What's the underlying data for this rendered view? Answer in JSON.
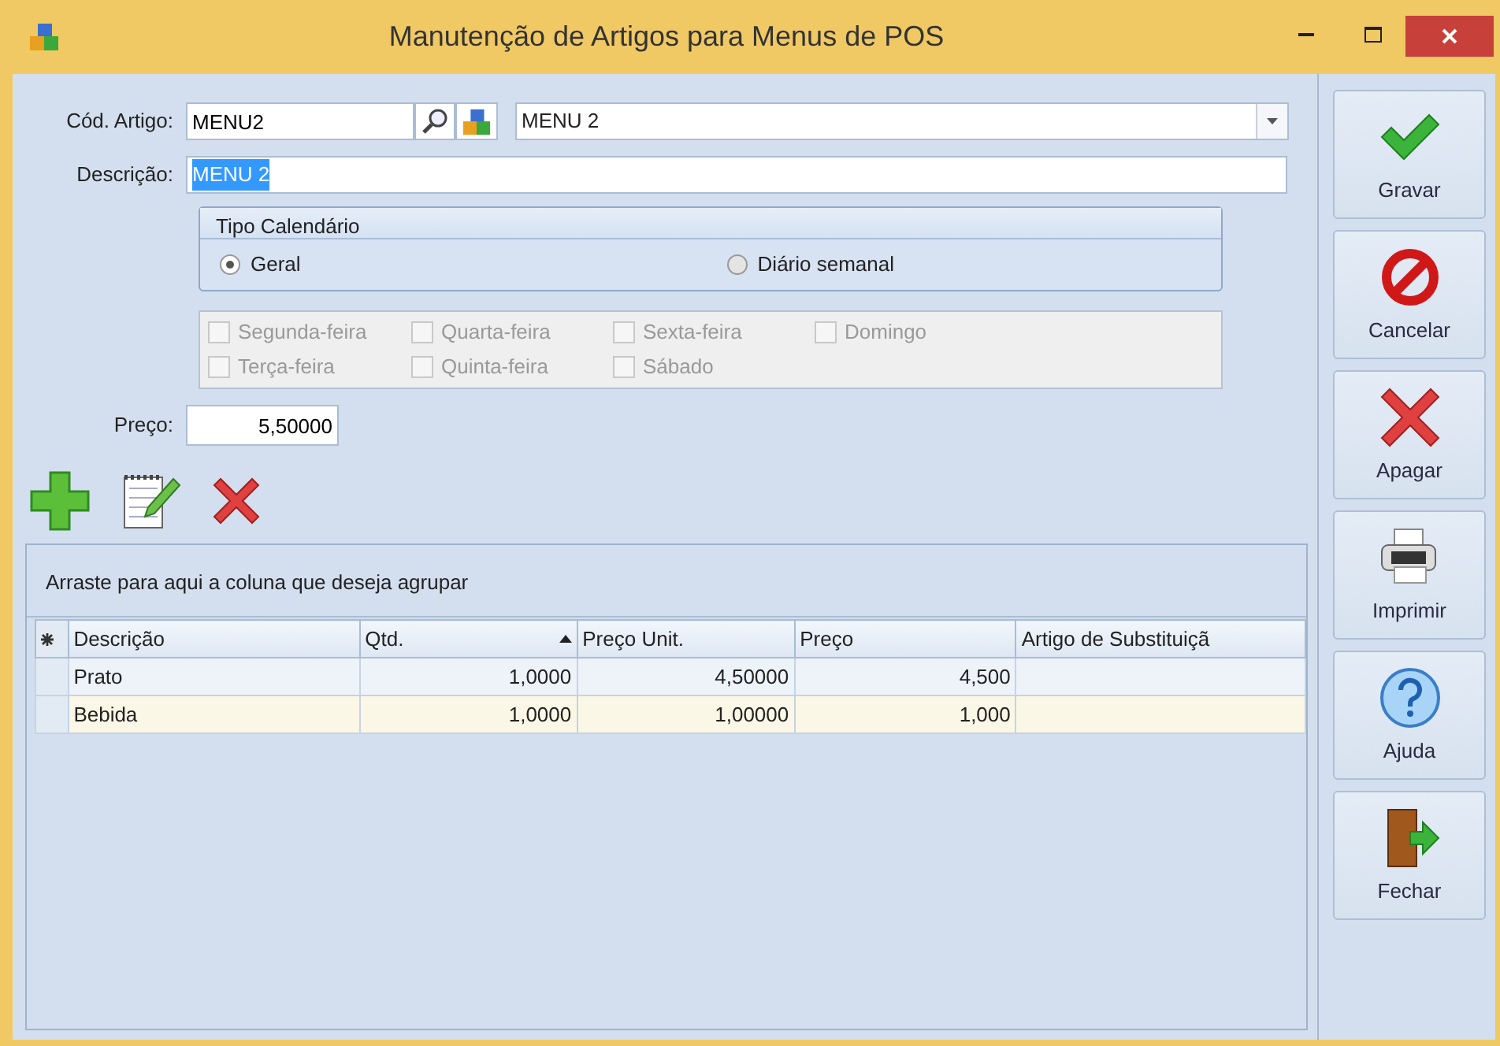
{
  "window": {
    "title": "Manutenção de Artigos para Menus de POS"
  },
  "form": {
    "cod_artigo": {
      "label": "Cód. Artigo:",
      "value": "MENU2"
    },
    "artigo_combo": {
      "value": "MENU 2"
    },
    "descricao": {
      "label": "Descrição:",
      "value": "MENU 2",
      "text_selected": true
    },
    "tipo_calendario": {
      "title": "Tipo Calendário",
      "options": [
        {
          "label": "Geral",
          "selected": true
        },
        {
          "label": "Diário semanal",
          "selected": false
        }
      ]
    },
    "days": [
      {
        "label": "Segunda-feira",
        "checked": false,
        "disabled": true
      },
      {
        "label": "Quarta-feira",
        "checked": false,
        "disabled": true
      },
      {
        "label": "Sexta-feira",
        "checked": false,
        "disabled": true
      },
      {
        "label": "Domingo",
        "checked": false,
        "disabled": true
      },
      {
        "label": "Terça-feira",
        "checked": false,
        "disabled": true
      },
      {
        "label": "Quinta-feira",
        "checked": false,
        "disabled": true
      },
      {
        "label": "Sábado",
        "checked": false,
        "disabled": true
      }
    ],
    "preco": {
      "label": "Preço:",
      "value": "5,50000"
    }
  },
  "toolbar": [
    {
      "kind": "add"
    },
    {
      "kind": "edit"
    },
    {
      "kind": "delete"
    }
  ],
  "grid": {
    "group_hint": "Arraste para aqui a coluna que deseja agrupar",
    "columns": [
      {
        "label": "Descrição",
        "sorted": false,
        "kind": "text"
      },
      {
        "label": "Qtd.",
        "sorted": true,
        "kind": "number"
      },
      {
        "label": "Preço Unit.",
        "sorted": false,
        "kind": "number"
      },
      {
        "label": "Preço",
        "sorted": false,
        "kind": "number"
      },
      {
        "label": "Artigo de Substituiçã",
        "sorted": false,
        "kind": "text"
      }
    ],
    "rows": [
      {
        "cells": [
          "Prato",
          "1,0000",
          "4,50000",
          "4,500",
          ""
        ]
      },
      {
        "cells": [
          "Bebida",
          "1,0000",
          "1,00000",
          "1,000",
          ""
        ]
      }
    ]
  },
  "side_buttons": [
    {
      "kind": "save",
      "label": "Gravar"
    },
    {
      "kind": "cancel",
      "label": "Cancelar"
    },
    {
      "kind": "delete",
      "label": "Apagar"
    },
    {
      "kind": "print",
      "label": "Imprimir"
    },
    {
      "kind": "help",
      "label": "Ajuda"
    },
    {
      "kind": "close",
      "label": "Fechar"
    }
  ]
}
